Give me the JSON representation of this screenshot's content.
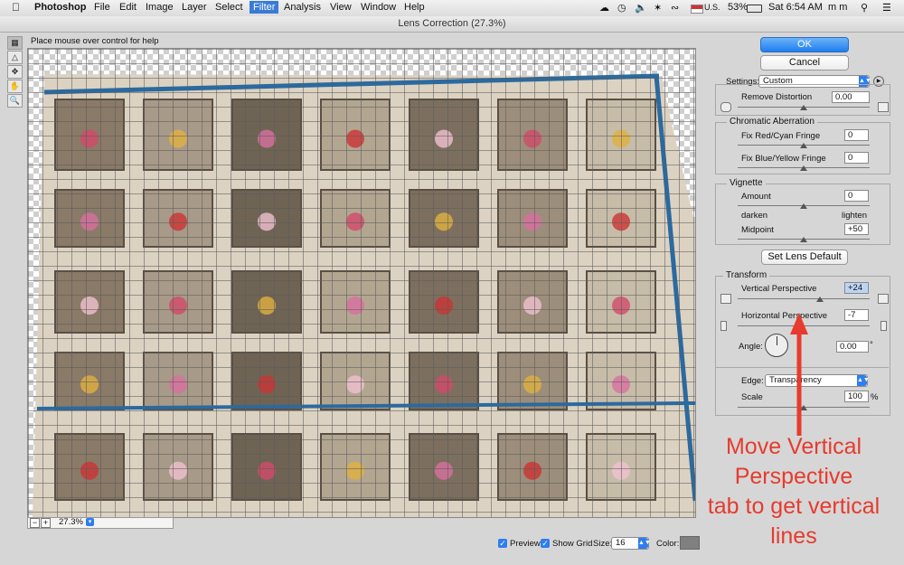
{
  "menubar": {
    "apple": "",
    "items": [
      "Photoshop",
      "File",
      "Edit",
      "Image",
      "Layer",
      "Select",
      "Filter",
      "Analysis",
      "View",
      "Window",
      "Help"
    ],
    "active": "Filter",
    "status": {
      "flag": "U.S.",
      "battery": "53%",
      "time": "Sat 6:54 AM",
      "user": "m m"
    }
  },
  "dialog": {
    "title": "Lens Correction (27.3%)",
    "help_text": "Place mouse over control for help"
  },
  "tools": [
    "remove-distortion-tool",
    "straighten-tool",
    "move-grid-tool",
    "hand-tool",
    "zoom-tool"
  ],
  "buttons": {
    "ok": "OK",
    "cancel": "Cancel",
    "set_lens_default": "Set Lens Default"
  },
  "settings": {
    "label": "Settings:",
    "value": "Custom"
  },
  "remove_distortion": {
    "label": "Remove Distortion",
    "value": "0.00",
    "level": 0.5
  },
  "chromatic": {
    "title": "Chromatic Aberration",
    "red_cyan": {
      "label": "Fix Red/Cyan Fringe",
      "value": "0",
      "level": 0.5
    },
    "blue_yellow": {
      "label": "Fix Blue/Yellow Fringe",
      "value": "0",
      "level": 0.5
    }
  },
  "vignette": {
    "title": "Vignette",
    "amount": {
      "label": "Amount",
      "value": "0",
      "level": 0.5
    },
    "darken": "darken",
    "lighten": "lighten",
    "midpoint": {
      "label": "Midpoint",
      "value": "+50",
      "level": 0.5
    }
  },
  "transform": {
    "title": "Transform",
    "vertical": {
      "label": "Vertical Perspective",
      "value": "+24",
      "level": 0.62
    },
    "horizontal": {
      "label": "Horizontal Perspective",
      "value": "-7",
      "level": 0.46
    },
    "angle": {
      "label": "Angle:",
      "value": "0.00",
      "unit": "°"
    },
    "edge": {
      "label": "Edge:",
      "value": "Transparency"
    },
    "scale": {
      "label": "Scale",
      "value": "100",
      "unit": "%",
      "level": 0.5
    }
  },
  "zoom": {
    "minus": "−",
    "plus": "+",
    "value": "27.3%"
  },
  "footer": {
    "preview": "Preview",
    "show_grid": "Show Grid",
    "size_label": "Size:",
    "size_value": "16",
    "color_label": "Color:",
    "grid_color": "#808080"
  },
  "annotation": [
    "Move Vertical",
    "Perspective",
    "tab to get vertical",
    "lines"
  ],
  "colors": {
    "accent": "#2f7df0",
    "annotation": "#e63b2e",
    "rail": "#2a6aa0"
  }
}
